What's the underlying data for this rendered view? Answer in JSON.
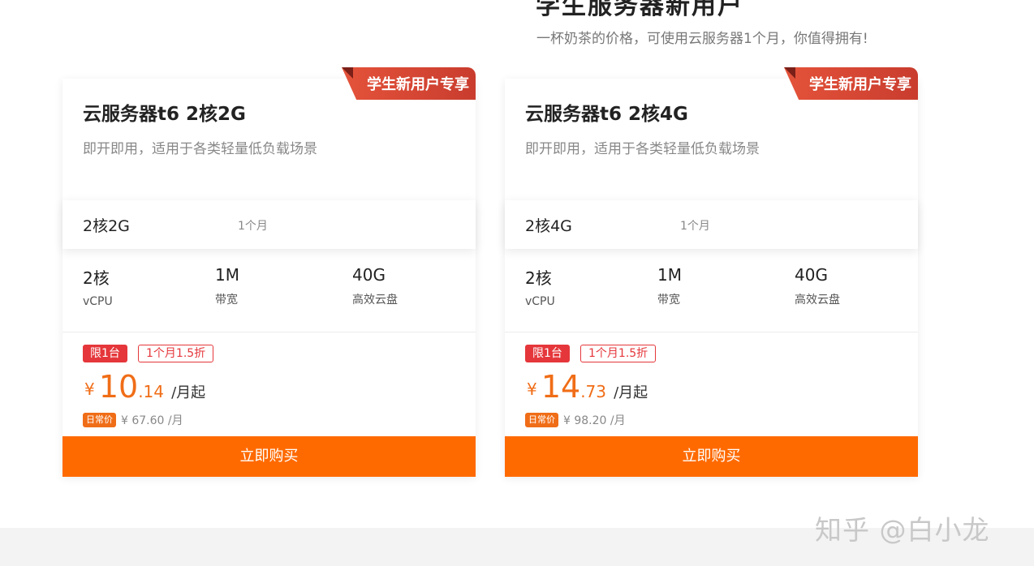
{
  "header": {
    "title": "学生服务器新用户",
    "subtitle": "一杯奶茶的价格，可使用云服务器1个月，你值得拥有!"
  },
  "cards": [
    {
      "ribbon": "学生新用户专享",
      "title": "云服务器t6 2核2G",
      "desc": "即开即用，适用于各类轻量低负载场景",
      "spec": "2核2G",
      "term": "1个月",
      "features": [
        {
          "value": "2核",
          "label": "vCPU"
        },
        {
          "value": "1M",
          "label": "带宽"
        },
        {
          "value": "40G",
          "label": "高效云盘"
        }
      ],
      "limit_badge": "限1台",
      "discount_badge": "1个月1.5折",
      "currency": "¥",
      "price_int": "10",
      "price_dec": ".14",
      "price_unit": "/月起",
      "regular_tag": "日常价",
      "regular_price": "¥ 67.60 /月",
      "buy_label": "立即购买"
    },
    {
      "ribbon": "学生新用户专享",
      "title": "云服务器t6 2核4G",
      "desc": "即开即用，适用于各类轻量低负载场景",
      "spec": "2核4G",
      "term": "1个月",
      "features": [
        {
          "value": "2核",
          "label": "vCPU"
        },
        {
          "value": "1M",
          "label": "带宽"
        },
        {
          "value": "40G",
          "label": "高效云盘"
        }
      ],
      "limit_badge": "限1台",
      "discount_badge": "1个月1.5折",
      "currency": "¥",
      "price_int": "14",
      "price_dec": ".73",
      "price_unit": "/月起",
      "regular_tag": "日常价",
      "regular_price": "¥ 98.20 /月",
      "buy_label": "立即购买"
    }
  ],
  "watermark": "知乎 @白小龙",
  "colors": {
    "accent": "#ff6a00",
    "ribbon": "#d94a35",
    "limit_red": "#e5373b",
    "price_orange": "#f06d17"
  }
}
